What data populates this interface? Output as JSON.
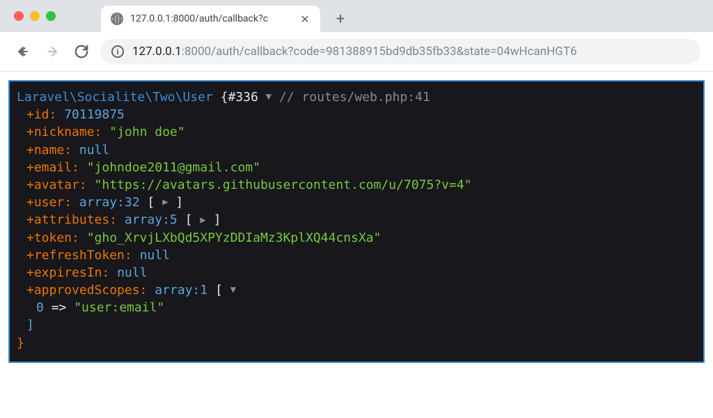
{
  "browser": {
    "tab_title": "127.0.0.1:8000/auth/callback?c",
    "url_host": "127.0.0.1",
    "url_path": ":8000/auth/callback?code=981388915bd9db35fb33&state=04wHcanHGT6",
    "plus": "+",
    "close_x": "✕"
  },
  "dump": {
    "class": "Laravel\\Socialite\\Two\\User",
    "header_tag": "{#336",
    "header_tri": "▼",
    "header_comment": "// routes/web.php:41",
    "id_key": "+id:",
    "id_val": "70119875",
    "nick_key": "+nickname:",
    "nick_val": "\"john doe\"",
    "name_key": "+name:",
    "name_val": "null",
    "email_key": "+email:",
    "email_val": "\"johndoe2011@gmail.com\"",
    "avatar_key": "+avatar:",
    "avatar_val": "\"https://avatars.githubusercontent.com/u/7075?v=4\"",
    "user_key": "+user:",
    "user_type": "array:32",
    "arr_open": " [",
    "tri_right": "▶",
    "arr_close": "]",
    "attrs_key": "+attributes:",
    "attrs_type": "array:5",
    "token_key": "+token:",
    "token_val": "\"gho_XrvjLXbQd5XPYzDDIaMz3KplXQ44cnsXa\"",
    "refresh_key": "+refreshToken:",
    "refresh_val": "null",
    "expires_key": "+expiresIn:",
    "expires_val": "null",
    "approved_key": "+approvedScopes:",
    "approved_type": "array:1",
    "tri_down": "▼",
    "scope_index": "0",
    "arrow": " => ",
    "scope_val": "\"user:email\"",
    "close_bracket": "]",
    "close_brace": "}"
  }
}
